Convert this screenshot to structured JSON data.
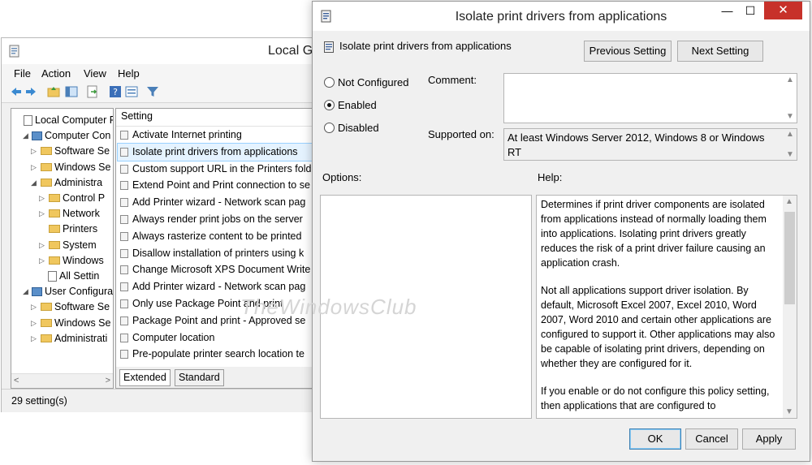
{
  "background_window": {
    "title": "Local G",
    "menu": [
      "File",
      "Action",
      "View",
      "Help"
    ],
    "tree": [
      {
        "label": "Local Computer P",
        "indent": 0,
        "expander": "",
        "icon": "doc"
      },
      {
        "label": "Computer Con",
        "indent": 1,
        "expander": "◢",
        "icon": "pc"
      },
      {
        "label": "Software Se",
        "indent": 2,
        "expander": "▷",
        "icon": "folder"
      },
      {
        "label": "Windows Se",
        "indent": 2,
        "expander": "▷",
        "icon": "folder"
      },
      {
        "label": "Administra",
        "indent": 2,
        "expander": "◢",
        "icon": "folder"
      },
      {
        "label": "Control P",
        "indent": 3,
        "expander": "▷",
        "icon": "folder"
      },
      {
        "label": "Network",
        "indent": 3,
        "expander": "▷",
        "icon": "folder"
      },
      {
        "label": "Printers",
        "indent": 3,
        "expander": "",
        "icon": "folder"
      },
      {
        "label": "System",
        "indent": 3,
        "expander": "▷",
        "icon": "folder"
      },
      {
        "label": "Windows",
        "indent": 3,
        "expander": "▷",
        "icon": "folder"
      },
      {
        "label": "All Settin",
        "indent": 3,
        "expander": "",
        "icon": "doc"
      },
      {
        "label": "User Configura",
        "indent": 1,
        "expander": "◢",
        "icon": "pc"
      },
      {
        "label": "Software Se",
        "indent": 2,
        "expander": "▷",
        "icon": "folder"
      },
      {
        "label": "Windows Se",
        "indent": 2,
        "expander": "▷",
        "icon": "folder"
      },
      {
        "label": "Administrati",
        "indent": 2,
        "expander": "▷",
        "icon": "folder"
      }
    ],
    "list_header": "Setting",
    "settings": [
      "Activate Internet printing",
      "Isolate print drivers from applications",
      "Custom support URL in the Printers fold",
      "Extend Point and Print connection to se",
      "Add Printer wizard - Network scan pag",
      "Always render print jobs on the server",
      "Always rasterize content to be printed",
      "Disallow installation of printers using k",
      "Change Microsoft XPS Document Write",
      "Add Printer wizard - Network scan pag",
      "Only use Package Point and print",
      "Package Point and print - Approved se",
      "Computer location",
      "Pre-populate printer search location te"
    ],
    "selected_setting_index": 1,
    "tabs": [
      "Extended",
      "Standard"
    ],
    "status": "29 setting(s)"
  },
  "dialog": {
    "title": "Isolate print drivers from applications",
    "subtitle": "Isolate print drivers from applications",
    "previous_setting": "Previous Setting",
    "next_setting": "Next Setting",
    "radio_options": [
      "Not Configured",
      "Enabled",
      "Disabled"
    ],
    "selected_option": "Enabled",
    "comment_label": "Comment:",
    "supported_label": "Supported on:",
    "supported_value": "At least Windows Server 2012, Windows 8 or Windows RT",
    "options_label": "Options:",
    "help_label": "Help:",
    "help_paragraphs": [
      "Determines if print driver components are isolated from applications instead of normally loading them into applications. Isolating print drivers greatly reduces the risk of a print driver failure causing an application crash.",
      "Not all applications support driver isolation. By default, Microsoft Excel 2007, Excel 2010, Word 2007, Word 2010 and certain other applications are configured to support it. Other applications may also be capable of isolating print drivers, depending on whether they are configured for it.",
      "If you enable or do not configure this policy setting, then applications that are configured to"
    ],
    "ok": "OK",
    "cancel": "Cancel",
    "apply": "Apply",
    "minimize_glyph": "—",
    "maximize_glyph": "☐",
    "close_glyph": "✕"
  },
  "watermark": "TheWindowsClub",
  "colors": {
    "close_button": "#c7312a",
    "selection_highlight": "#e5f3ff",
    "selection_border": "#99d1ff"
  }
}
